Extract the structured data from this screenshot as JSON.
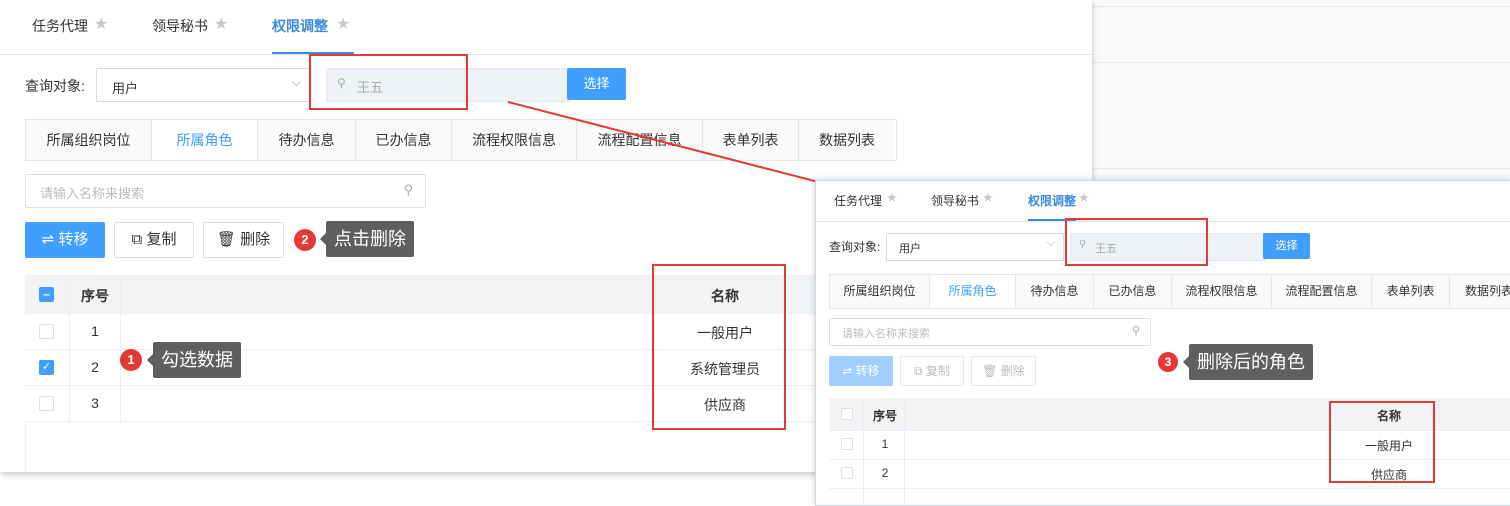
{
  "tabs": [
    {
      "label": "任务代理"
    },
    {
      "label": "领导秘书"
    },
    {
      "label": "权限调整"
    }
  ],
  "query": {
    "label": "查询对象:",
    "object_type": "用户",
    "user_value": "王五",
    "select_button": "选择"
  },
  "subtabs": [
    "所属组织岗位",
    "所属角色",
    "待办信息",
    "已办信息",
    "流程权限信息",
    "流程配置信息",
    "表单列表",
    "数据列表"
  ],
  "search_placeholder": "请输入名称来搜索",
  "actions": {
    "transfer": "⇌ 转移",
    "copy": "复制",
    "delete": "删除"
  },
  "table": {
    "col_index": "序号",
    "col_name": "名称",
    "rows_before": [
      {
        "index": "1",
        "name": "一般用户",
        "checked": false
      },
      {
        "index": "2",
        "name": "系统管理员",
        "checked": true
      },
      {
        "index": "3",
        "name": "供应商",
        "checked": false
      }
    ],
    "rows_after": [
      {
        "index": "1",
        "name": "一般用户"
      },
      {
        "index": "2",
        "name": "供应商"
      }
    ]
  },
  "annotations": [
    {
      "num": "1",
      "text": "勾选数据"
    },
    {
      "num": "2",
      "text": "点击删除"
    },
    {
      "num": "3",
      "text": "删除后的角色"
    }
  ],
  "colors": {
    "accent": "#409eff",
    "tab_active": "#3c8dde",
    "annotation_red": "#e53935",
    "tip_bg": "#5f5f5f"
  }
}
